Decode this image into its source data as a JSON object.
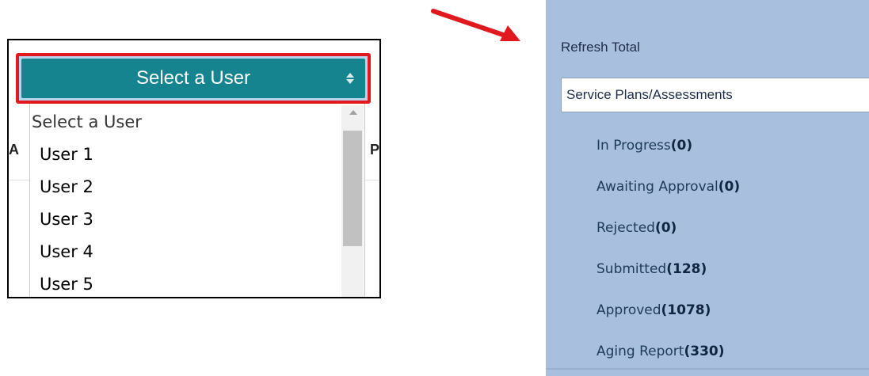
{
  "user_dropdown": {
    "selected_label": "Select a User",
    "options": [
      "Select a User",
      "User 1",
      "User 2",
      "User 3",
      "User 4",
      "User 5"
    ],
    "background_column_left": "A",
    "background_column_right": "P",
    "accent_color": "#15848e",
    "highlight_color": "#e0191e",
    "icon": "sort-arrows-icon"
  },
  "annotation": {
    "arrow_color": "#e0191e",
    "icon": "red-arrow-icon"
  },
  "side_panel": {
    "refresh_label": "Refresh Total",
    "category_selected": "Service Plans/Assessments",
    "background_color": "#a8bfdd",
    "statuses": [
      {
        "label": "In Progress",
        "count": "(0)"
      },
      {
        "label": "Awaiting Approval",
        "count": "(0)"
      },
      {
        "label": "Rejected",
        "count": "(0)"
      },
      {
        "label": "Submitted",
        "count": "(128)"
      },
      {
        "label": "Approved",
        "count": "(1078)"
      },
      {
        "label": "Aging Report",
        "count": "(330)"
      }
    ]
  }
}
